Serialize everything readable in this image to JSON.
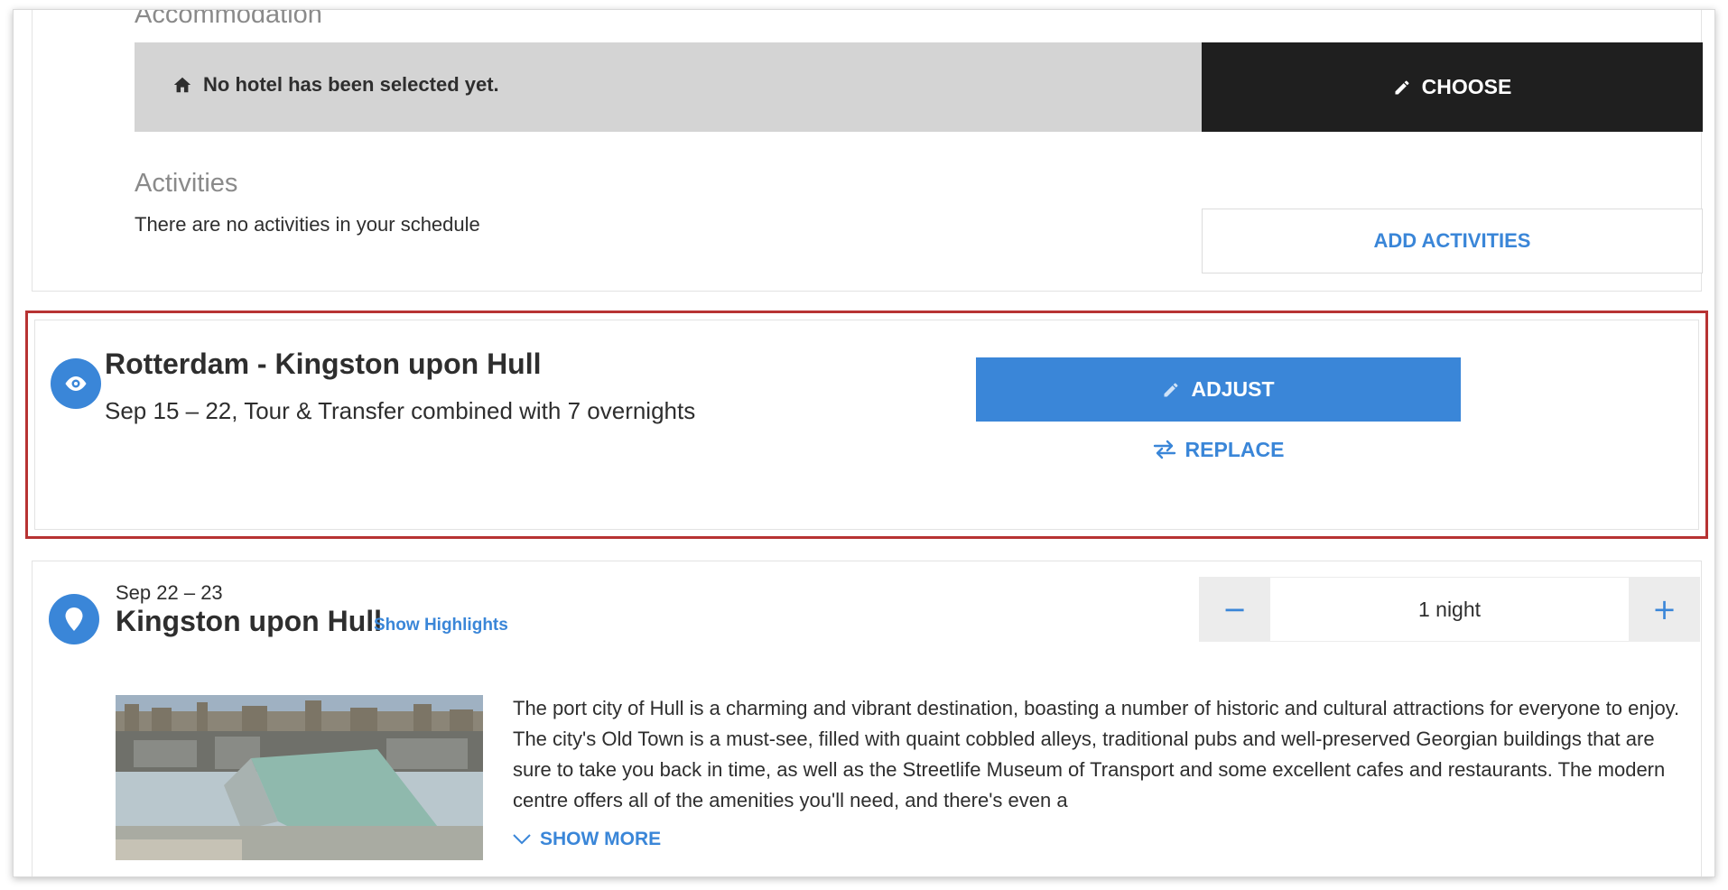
{
  "accommodation": {
    "title": "Accommodation",
    "empty_text": "No hotel has been selected yet.",
    "choose_label": "CHOOSE"
  },
  "activities": {
    "title": "Activities",
    "empty_text": "There are no activities in your schedule",
    "add_label": "ADD ACTIVITIES"
  },
  "transfer": {
    "title": "Rotterdam - Kingston upon Hull",
    "subtitle": "Sep 15 – 22, Tour & Transfer combined with 7 overnights",
    "adjust_label": "ADJUST",
    "replace_label": "REPLACE"
  },
  "destination": {
    "dates": "Sep 22 – 23",
    "city": "Kingston upon Hull",
    "highlights_label": "Show Highlights",
    "nights_value": "1 night",
    "minus_symbol": "−",
    "plus_symbol": "+",
    "description": "The port city of Hull is a charming and vibrant destination, boasting a number of historic and cultural attractions for everyone to enjoy. The city's Old Town is a must-see, filled with quaint cobbled alleys, traditional pubs and well-preserved Georgian buildings that are sure to take you back in time, as well as the Streetlife Museum of Transport and some excellent cafes and restaurants. The modern centre offers all of the amenities you'll need, and there's even a",
    "show_more_label": "SHOW MORE"
  },
  "colors": {
    "accent": "#3a86d8",
    "dark_button": "#1f1f1f",
    "highlight_border": "#b73333",
    "hotel_bar": "#d4d4d4"
  }
}
